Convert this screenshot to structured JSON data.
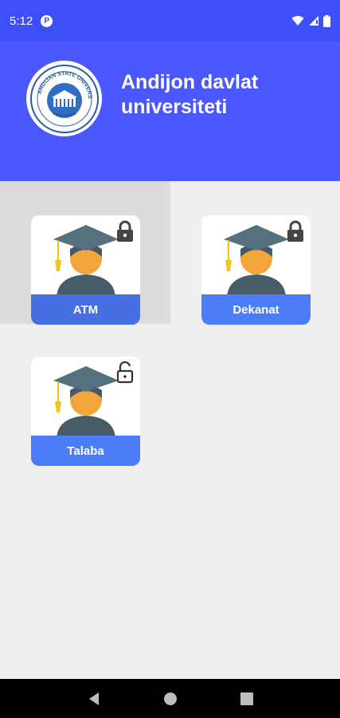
{
  "status_bar": {
    "time": "5:12",
    "notification_icon": "p-icon",
    "icons": [
      "wifi-icon",
      "signal-icon",
      "battery-icon"
    ]
  },
  "header": {
    "title": "Andijon davlat universiteti",
    "logo": "andijan-state-university-logo",
    "logo_text": "ANDIJAN STATE UNIVERSITY"
  },
  "cards": [
    {
      "label": "ATM",
      "lock_state": "locked",
      "icon": "graduate-icon"
    },
    {
      "label": "Dekanat",
      "lock_state": "locked",
      "icon": "graduate-icon"
    },
    {
      "label": "Talaba",
      "lock_state": "unlocked",
      "icon": "graduate-icon"
    }
  ],
  "nav_bar": {
    "buttons": [
      "back-icon",
      "home-icon",
      "recents-icon"
    ]
  },
  "colors": {
    "header": "#4a57fd",
    "status_bar": "#3d4ff6",
    "card_label": "#4c7cf8",
    "background": "#efefef"
  }
}
